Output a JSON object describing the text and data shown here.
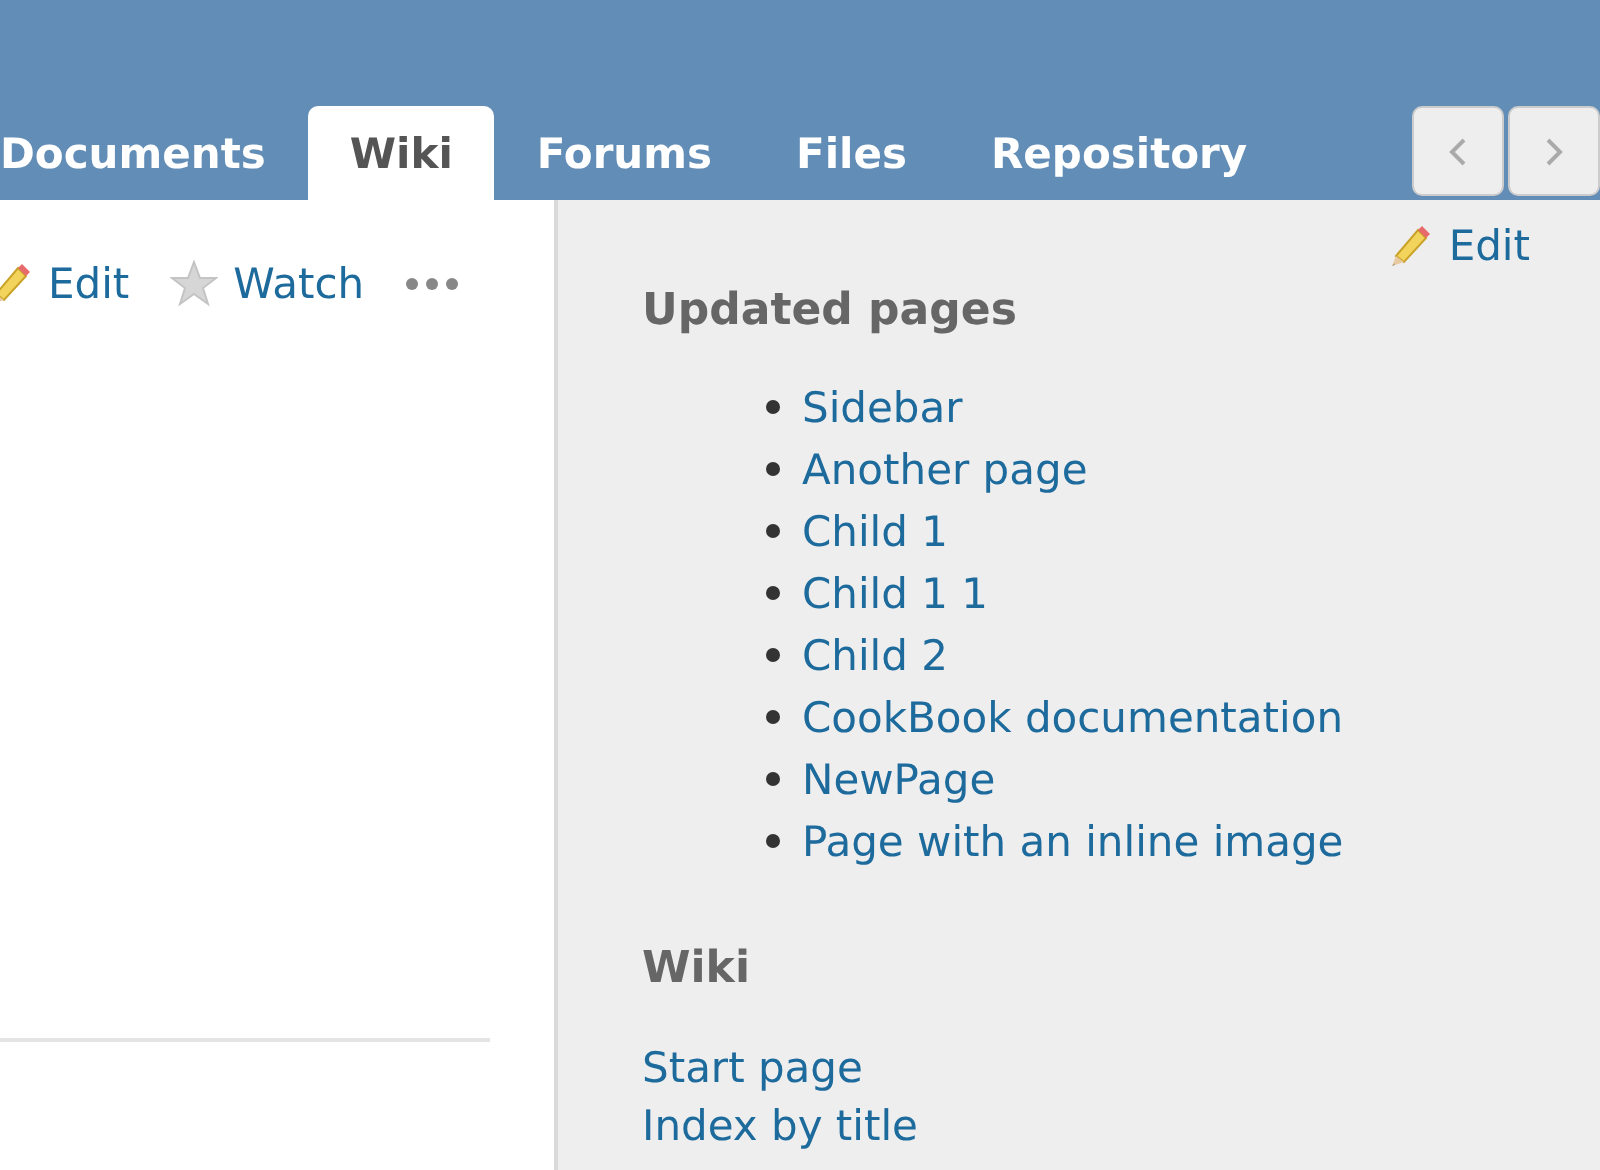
{
  "tabs": [
    {
      "label": "Documents",
      "selected": false
    },
    {
      "label": "Wiki",
      "selected": true
    },
    {
      "label": "Forums",
      "selected": false
    },
    {
      "label": "Files",
      "selected": false
    },
    {
      "label": "Repository",
      "selected": false
    }
  ],
  "actions": [
    {
      "label": "Edit",
      "kind": "edit"
    },
    {
      "label": "Watch",
      "kind": "watch"
    }
  ],
  "sidebar": {
    "edit_link": "Edit",
    "sections": [
      {
        "title": "Updated pages",
        "kind": "bullets",
        "items": [
          "Sidebar",
          "Another page",
          "Child 1",
          "Child 1 1",
          "Child 2",
          "CookBook documentation",
          "NewPage",
          "Page with an inline image"
        ]
      },
      {
        "title": "Wiki",
        "kind": "plain",
        "items": [
          "Start page",
          "Index by title"
        ]
      }
    ]
  }
}
